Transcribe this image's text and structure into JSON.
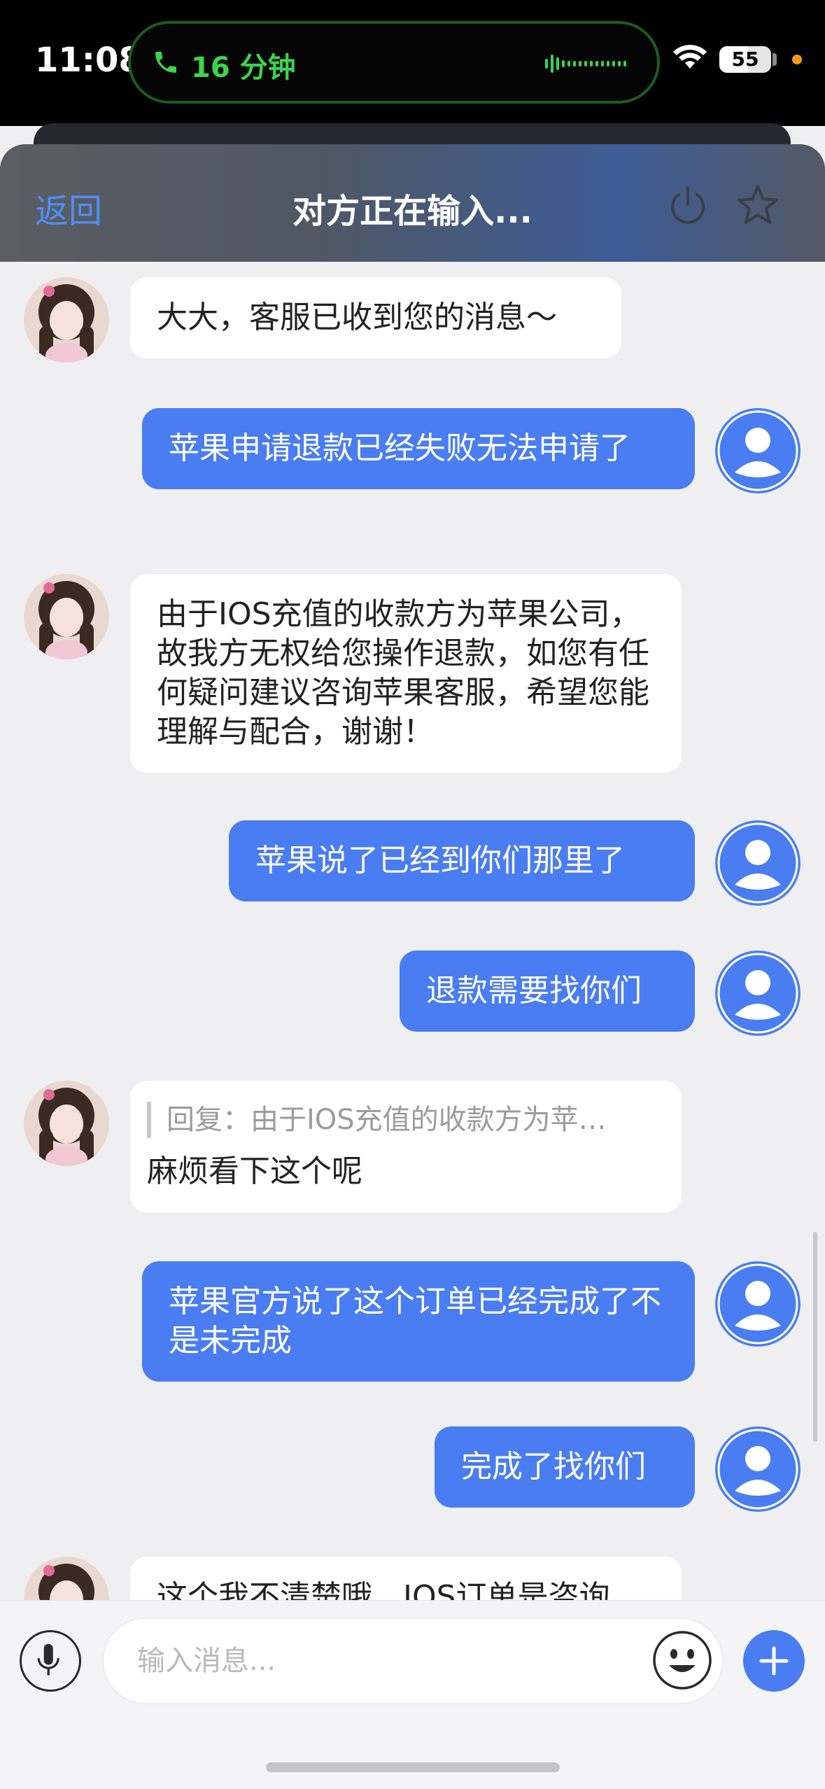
{
  "status_bar": {
    "time": "11:08",
    "call_duration": "16 分钟",
    "battery_level": "55",
    "battery_fraction": 0.55
  },
  "nav": {
    "back_label": "返回",
    "title": "对方正在输入...",
    "accent_color": "#4f8ef7"
  },
  "messages": [
    {
      "from": "agent",
      "text": "大大，客服已收到您的消息～"
    },
    {
      "from": "user",
      "text": "苹果申请退款已经失败无法申请了"
    },
    {
      "from": "agent",
      "text": "由于IOS充值的收款方为苹果公司，故我方无权给您操作退款，如您有任何疑问建议咨询苹果客服，希望您能理解与配合，谢谢！"
    },
    {
      "from": "user",
      "text": "苹果说了已经到你们那里了"
    },
    {
      "from": "user",
      "text": "退款需要找你们"
    },
    {
      "from": "agent",
      "quote": "回复：由于IOS充值的收款方为苹…",
      "text": "麻烦看下这个呢"
    },
    {
      "from": "user",
      "text": "苹果官方说了这个订单已经完成了不是未完成"
    },
    {
      "from": "user",
      "text": "完成了找你们"
    },
    {
      "from": "agent",
      "text": "这个我不清楚哦，IOS订单是咨询"
    }
  ],
  "composer": {
    "placeholder": "输入消息..."
  },
  "colors": {
    "user_bubble": "#4a7df2",
    "agent_bubble": "#ffffff",
    "background": "#efeff1"
  },
  "icons": {
    "call": "phone-icon",
    "signal_wave": "audio-wave-icon",
    "wifi": "wifi-icon",
    "power": "power-icon",
    "favorite": "star-icon",
    "mic": "microphone-icon",
    "emoji": "smiley-icon",
    "add": "plus-icon"
  }
}
